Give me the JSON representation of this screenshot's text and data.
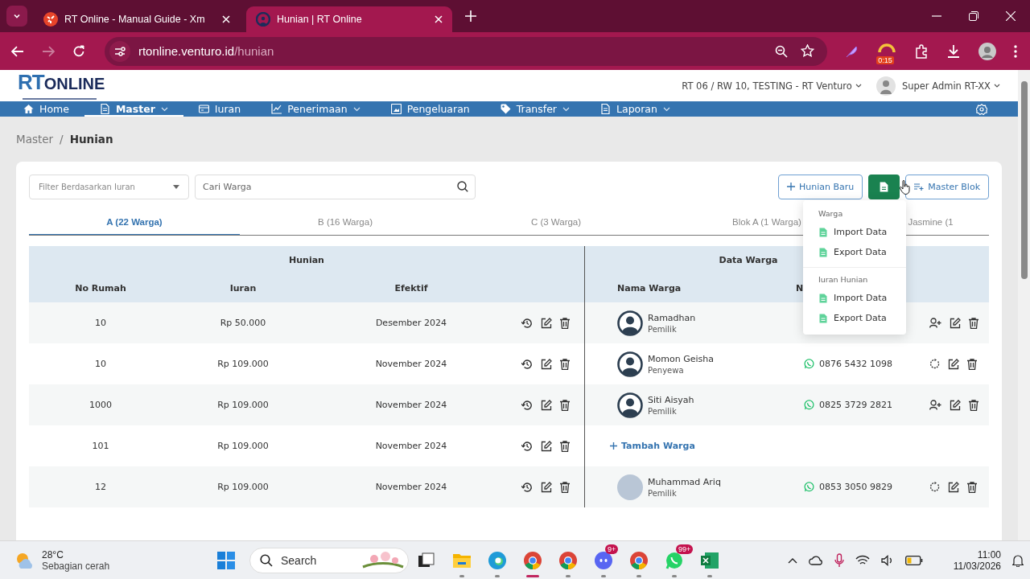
{
  "browser": {
    "tabs": [
      {
        "title": "RT Online - Manual Guide - Xm",
        "selected": false
      },
      {
        "title": "Hunian | RT Online",
        "selected": true
      }
    ],
    "url_host": "rtonline.venturo.id",
    "url_path": "/hunian",
    "timer_badge": "0:15"
  },
  "header": {
    "logo_a": "RT",
    "logo_b": "ONLINE",
    "location": "RT 06 / RW 10, TESTING - RT Venturo",
    "user": "Super Admin RT-XX"
  },
  "nav": [
    {
      "kind": "home",
      "label": "Home",
      "dropdown": false,
      "selected": false
    },
    {
      "kind": "document",
      "label": "Master",
      "dropdown": true,
      "selected": true
    },
    {
      "kind": "card",
      "label": "Iuran",
      "dropdown": false,
      "selected": false
    },
    {
      "kind": "chart",
      "label": "Penerimaan",
      "dropdown": true,
      "selected": false
    },
    {
      "kind": "picture",
      "label": "Pengeluaran",
      "dropdown": false,
      "selected": false
    },
    {
      "kind": "tag",
      "label": "Transfer",
      "dropdown": true,
      "selected": false
    },
    {
      "kind": "document",
      "label": "Laporan",
      "dropdown": true,
      "selected": false
    }
  ],
  "breadcrumb": [
    "Master",
    "Hunian"
  ],
  "breadcrumb_separator": "/",
  "filter": {
    "placeholder": "Filter Berdasarkan Iuran"
  },
  "search": {
    "placeholder": "Cari Warga"
  },
  "buttons": {
    "new": "Hunian Baru",
    "master": "Master Blok"
  },
  "menu": [
    {
      "heading": "Warga",
      "items": [
        "Import Data",
        "Export Data"
      ]
    },
    {
      "heading": "Iuran Hunian",
      "items": [
        "Import Data",
        "Export Data"
      ]
    }
  ],
  "tabs": [
    {
      "label": "A (22 Warga)",
      "selected": true
    },
    {
      "label": "B (16 Warga)",
      "selected": false
    },
    {
      "label": "C (3 Warga)",
      "selected": false
    },
    {
      "label": "Blok A (1 Warga)",
      "selected": false
    },
    {
      "label": "Jasmine (1",
      "selected": false
    }
  ],
  "table": {
    "groups": [
      "Hunian",
      "Data Warga"
    ],
    "columns": [
      "No Rumah",
      "Iuran",
      "Efektif",
      "Nama Warga",
      "N"
    ],
    "add_label": "Tambah Warga",
    "rows": [
      {
        "no_rumah": "10",
        "iuran": "Rp 50.000",
        "efektif": "Desember 2024",
        "warga": {
          "name": "Ramadhan",
          "role": "Pemilik",
          "kind": "generic"
        },
        "kind": "add-user"
      },
      {
        "no_rumah": "10",
        "iuran": "Rp 109.000",
        "efektif": "November 2024",
        "warga": {
          "name": "Momon Geisha",
          "role": "Penyewa",
          "kind": "generic"
        },
        "phone": "0876 5432 1098",
        "kind": "reset"
      },
      {
        "no_rumah": "1000",
        "iuran": "Rp 109.000",
        "efektif": "November 2024",
        "warga": {
          "name": "Siti Aisyah",
          "role": "Pemilik",
          "kind": "generic"
        },
        "phone": "0825 3729 2821",
        "kind": "add-user"
      },
      {
        "no_rumah": "101",
        "iuran": "Rp 109.000",
        "efektif": "November 2024",
        "kind": "empty"
      },
      {
        "no_rumah": "12",
        "iuran": "Rp 109.000",
        "efektif": "November 2024",
        "warga": {
          "name": "Muhammad Ariq",
          "role": "Pemilik",
          "kind": "photo"
        },
        "phone": "0853 3050 9829",
        "kind": "reset"
      }
    ]
  },
  "taskbar": {
    "temp": "28°C",
    "weather": "Sebagian cerah",
    "search": "Search",
    "apps": [
      {
        "kind": "taskview",
        "active": false,
        "current": false
      },
      {
        "kind": "folder",
        "active": true,
        "current": false
      },
      {
        "kind": "edge",
        "active": true,
        "current": false
      },
      {
        "kind": "chrome",
        "active": true,
        "current": true
      },
      {
        "kind": "chrome",
        "active": true,
        "current": false
      },
      {
        "kind": "discord",
        "active": true,
        "current": false,
        "badge": "9+"
      },
      {
        "kind": "chrome",
        "active": true,
        "current": false
      },
      {
        "kind": "whatsapp",
        "active": true,
        "current": false,
        "badge": "99+"
      },
      {
        "kind": "excel",
        "active": true,
        "current": false
      }
    ],
    "time": "11:00",
    "date": "11/03/2026"
  }
}
